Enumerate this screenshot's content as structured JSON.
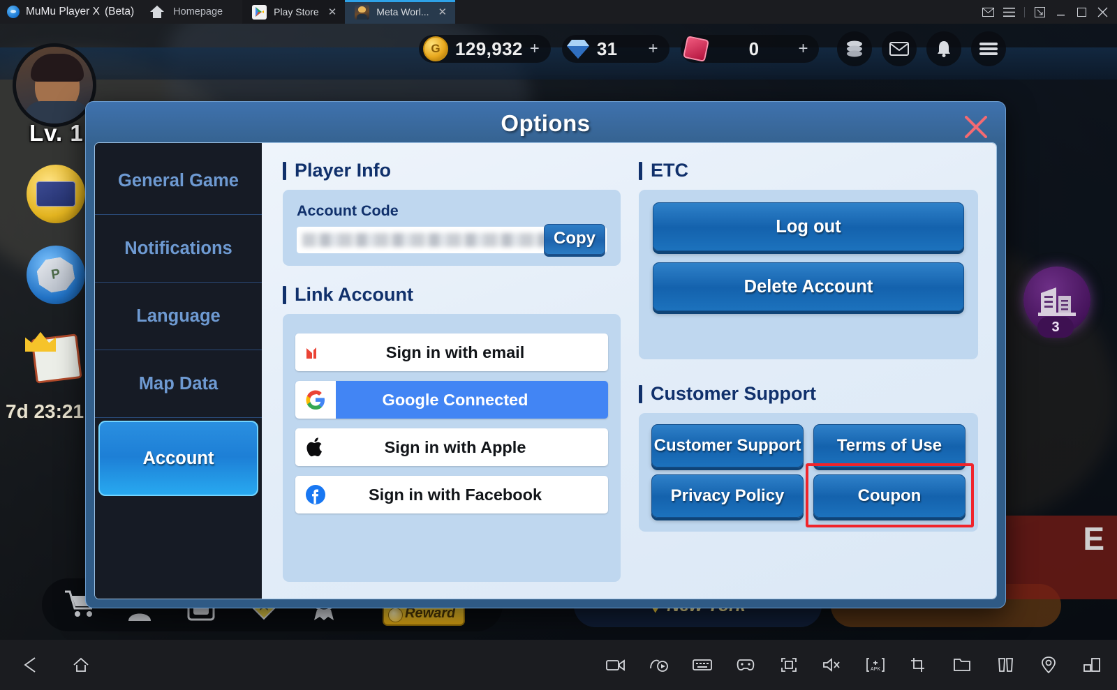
{
  "emulator": {
    "app_name": "MuMu Player X",
    "app_suffix": "(Beta)",
    "home_label": "Homepage",
    "tabs": [
      {
        "label": "Play Store",
        "icon": "play-store-icon",
        "close": "✕",
        "active": false
      },
      {
        "label": "Meta Worl...",
        "icon": "game-avatar-icon",
        "close": "✕",
        "active": true
      }
    ],
    "window_controls": [
      "mail-icon",
      "menu-icon",
      "restore-icon",
      "minimize-icon",
      "maximize-icon",
      "close-icon"
    ],
    "bottom_left_icons": [
      "back-icon",
      "home-icon"
    ],
    "bottom_right_icons": [
      "record-video-icon",
      "screenshot-video-icon",
      "keyboard-mapping-icon",
      "gamepad-icon",
      "fullscreen-icon",
      "mute-icon",
      "apk-install-icon",
      "crop-icon",
      "folder-icon",
      "multi-instance-icon",
      "location-icon",
      "resize-icon"
    ]
  },
  "game_hud": {
    "coins": "129,932",
    "gems": "31",
    "dice": "0",
    "plus": "+",
    "level": "Lv. 1",
    "timer": "7d 23:21",
    "city_count": "3",
    "reward_label": "Reward",
    "location": "New York",
    "event_text": "E",
    "right_icons": [
      "coin-stack-icon",
      "mail-icon",
      "bell-icon",
      "hamburger-menu-icon"
    ],
    "dock_icons": [
      "shop-cart-icon",
      "character-icon",
      "cards-icon",
      "ticket-icon",
      "medal-icon"
    ],
    "shop_badge": "!"
  },
  "dialog": {
    "title": "Options",
    "close_label": "✕",
    "sidebar": {
      "items": [
        {
          "label": "General Game",
          "active": false
        },
        {
          "label": "Notifications",
          "active": false
        },
        {
          "label": "Language",
          "active": false
        },
        {
          "label": "Map Data",
          "active": false
        },
        {
          "label": "Account",
          "active": true
        }
      ]
    },
    "player_info": {
      "section_title": "Player Info",
      "field_label": "Account Code",
      "account_code_value": "",
      "account_code_redacted": true,
      "copy_label": "Copy"
    },
    "link_account": {
      "section_title": "Link Account",
      "options": [
        {
          "label": "Sign in with email",
          "icon": "gmail-icon",
          "connected": false
        },
        {
          "label": "Google Connected",
          "icon": "google-icon",
          "connected": true
        },
        {
          "label": "Sign in with Apple",
          "icon": "apple-icon",
          "connected": false
        },
        {
          "label": "Sign in with Facebook",
          "icon": "facebook-icon",
          "connected": false
        }
      ]
    },
    "etc": {
      "section_title": "ETC",
      "buttons": [
        {
          "label": "Log out"
        },
        {
          "label": "Delete Account"
        }
      ]
    },
    "customer_support": {
      "section_title": "Customer Support",
      "buttons": [
        {
          "label": "Customer Support",
          "highlighted": false
        },
        {
          "label": "Terms of Use",
          "highlighted": false
        },
        {
          "label": "Privacy Policy",
          "highlighted": false
        },
        {
          "label": "Coupon",
          "highlighted": true
        }
      ]
    }
  },
  "colors": {
    "dialog_header_blue": "#3f72ae",
    "accent_blue": "#1d7fd6",
    "button_blue": "#1462ad",
    "section_title_navy": "#10306b",
    "panel_blue": "#bfd7ef",
    "highlight_red": "#f0242b",
    "google_blue": "#4285f4",
    "sidebar_dark": "#161b25"
  }
}
